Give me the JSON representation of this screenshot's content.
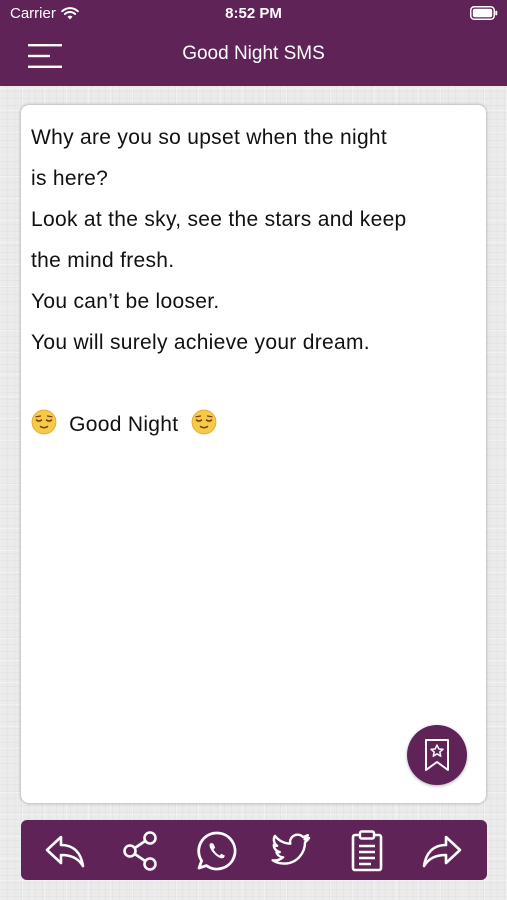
{
  "status_bar": {
    "carrier": "Carrier",
    "time": "8:52 PM"
  },
  "header": {
    "title": "Good Night SMS"
  },
  "message": {
    "lines": [
      "Why are you so upset when the night",
      "is here?",
      "Look at the sky, see the stars and keep",
      "the mind fresh.",
      "You can’t be looser.",
      "You will surely achieve your dream."
    ],
    "closing": "Good Night",
    "closing_emoji": "relieved-face"
  },
  "fab": {
    "icon": "bookmark-star-icon"
  },
  "toolbar": {
    "icons": [
      "reply-icon",
      "share-icon",
      "whatsapp-icon",
      "twitter-icon",
      "clipboard-icon",
      "forward-icon"
    ]
  },
  "colors": {
    "primary": "#5f2358",
    "text": "#111111",
    "emoji_face": "#f7c948"
  }
}
